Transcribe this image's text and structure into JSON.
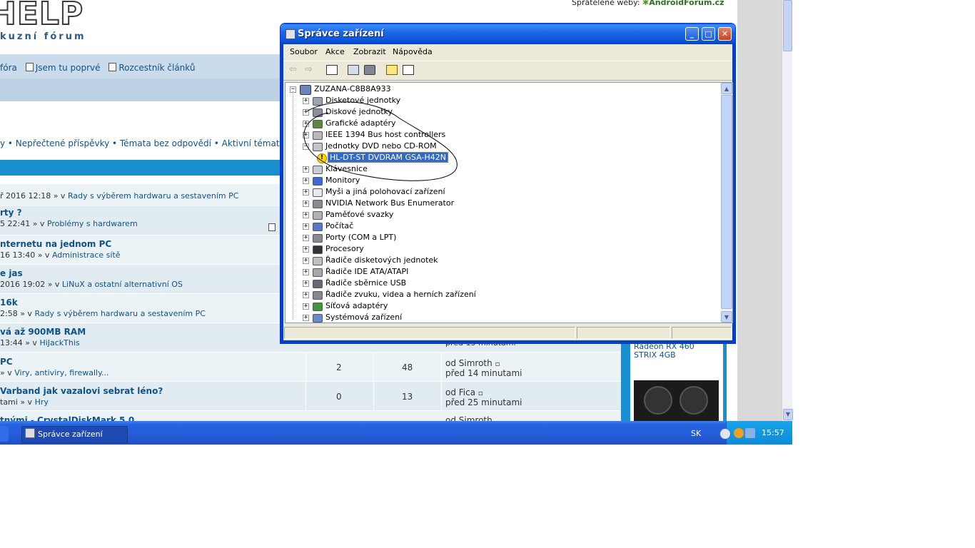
{
  "forum": {
    "logo": "HELP",
    "logo_sub": "kuzní fórum",
    "friends_label": "Spřátelené weby:",
    "friends_site": "AndroidForum.cz",
    "nav": [
      "fóra",
      "Jsem tu poprvé",
      "Rozcestník článků"
    ],
    "quick_links": "y • Nepřečtené příspěvky • Témata bez odpovědí • Aktivní témata",
    "topics": [
      {
        "title": "",
        "sub": "ř 2016 12:18 » v ",
        "forum": "Rady s výběrem hardwaru a sestavením PC",
        "replies": "",
        "views": "",
        "by": ""
      },
      {
        "title": "rty ?",
        "sub": "5 22:41 » v ",
        "forum": "Problémy s hardwarem",
        "replies": "",
        "views": "",
        "by": ""
      },
      {
        "title": "nternetu na jednom PC",
        "sub": "16 13:40 » v ",
        "forum": "Administrace sítě",
        "replies": "",
        "views": "",
        "by": ""
      },
      {
        "title": "e jas",
        "sub": "2016 19:02 » v ",
        "forum": "LiNuX a ostatní alternativní OS",
        "replies": "",
        "views": "",
        "by": ""
      },
      {
        "title": "16k",
        "sub": "2:58 » v ",
        "forum": "Rady s výběrem hardwaru a sestavením PC",
        "replies": "",
        "views": "",
        "by": ""
      },
      {
        "title": "vá až 900MB RAM",
        "sub": "13:44 » v ",
        "forum": "HiJackThis",
        "replies": "",
        "views": "",
        "by": "před 13 minutami"
      },
      {
        "title": "PC",
        "sub": " » v ",
        "forum": "Viry, antiviry, firewally...",
        "replies": "2",
        "views": "48",
        "by": "od Simroth",
        "when": "před 14 minutami"
      },
      {
        "title": "Varband jak vazalovi sebrat léno?",
        "sub": "tami » v ",
        "forum": "Hry",
        "replies": "0",
        "views": "13",
        "by": "od Fica",
        "when": "před 25 minutami"
      },
      {
        "title": "tnými - CrystalDiskMark 5.0",
        "sub": "",
        "forum": "",
        "replies": "",
        "views": "",
        "by": "od Simroth"
      }
    ],
    "ad_text_1": "Radeon RX 460",
    "ad_text_2": "STRIX 4GB"
  },
  "taskbar": {
    "item_label": "Správce zařízení",
    "lang": "SK",
    "clock": "15:57"
  },
  "window": {
    "title": "Správce zařízení",
    "menu": [
      "Soubor",
      "Akce",
      "Zobrazit",
      "Nápověda"
    ],
    "root": "ZUZANA-C8B8A933",
    "nodes": [
      {
        "label": "Disketové jednotky",
        "expander": "+",
        "icon": "floppy-icon"
      },
      {
        "label": "Diskové jednotky",
        "expander": "+",
        "icon": "disk-icon"
      },
      {
        "label": "Grafické adaptéry",
        "expander": "+",
        "icon": "display-adapter-icon"
      },
      {
        "label": "IEEE 1394 Bus host controllers",
        "expander": "+",
        "icon": "firewire-icon"
      },
      {
        "label": "Jednotky DVD nebo CD-ROM",
        "expander": "−",
        "icon": "dvd-icon"
      },
      {
        "label": "HL-DT-ST DVDRAM GSA-H42N",
        "expander": "",
        "icon": "warning-icon",
        "child": true,
        "selected": true
      },
      {
        "label": "Klávesnice",
        "expander": "+",
        "icon": "keyboard-icon"
      },
      {
        "label": "Monitory",
        "expander": "+",
        "icon": "monitor-icon"
      },
      {
        "label": "Myši a jiná polohovací zařízení",
        "expander": "+",
        "icon": "mouse-icon"
      },
      {
        "label": "NVIDIA Network Bus Enumerator",
        "expander": "+",
        "icon": "network-bus-icon"
      },
      {
        "label": "Paměťové svazky",
        "expander": "+",
        "icon": "volume-icon"
      },
      {
        "label": "Počítač",
        "expander": "+",
        "icon": "computer-icon"
      },
      {
        "label": "Porty (COM a LPT)",
        "expander": "+",
        "icon": "port-icon"
      },
      {
        "label": "Procesory",
        "expander": "+",
        "icon": "cpu-icon"
      },
      {
        "label": "Řadiče disketových jednotek",
        "expander": "+",
        "icon": "floppy-controller-icon"
      },
      {
        "label": "Řadiče IDE ATA/ATAPI",
        "expander": "+",
        "icon": "ide-icon"
      },
      {
        "label": "Řadiče sběrnice USB",
        "expander": "+",
        "icon": "usb-icon"
      },
      {
        "label": "Řadiče zvuku, videa a herních zařízení",
        "expander": "+",
        "icon": "sound-icon"
      },
      {
        "label": "Síťová adaptéry",
        "expander": "+",
        "icon": "network-adapter-icon"
      },
      {
        "label": "Systémová zařízení",
        "expander": "+",
        "icon": "system-device-icon"
      }
    ]
  },
  "colors": {
    "xp_blue": "#0a52d6",
    "selection": "#316ac5",
    "forum_blue": "#1a8fd0",
    "link": "#105289"
  }
}
